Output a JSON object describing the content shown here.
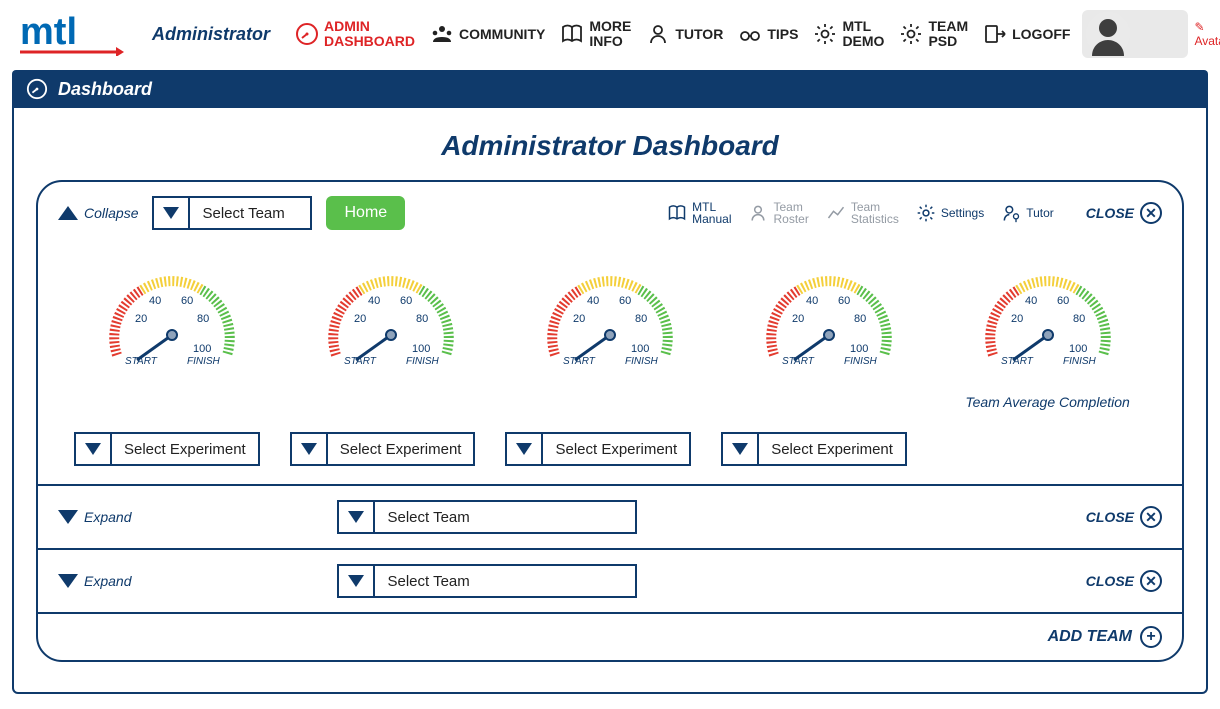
{
  "brand": "mtl",
  "role": "Administrator",
  "nav": [
    {
      "id": "admin-dashboard",
      "line1": "ADMIN",
      "line2": "DASHBOARD",
      "icon": "gauge",
      "active": true
    },
    {
      "id": "community",
      "line1": "COMMUNITY",
      "line2": "",
      "icon": "community",
      "active": false
    },
    {
      "id": "more-info",
      "line1": "MORE",
      "line2": "INFO",
      "icon": "book",
      "active": false
    },
    {
      "id": "tutor",
      "line1": "TUTOR",
      "line2": "",
      "icon": "tutor",
      "active": false
    },
    {
      "id": "tips",
      "line1": "TIPS",
      "line2": "",
      "icon": "glasses",
      "active": false
    },
    {
      "id": "mtl-demo",
      "line1": "MTL",
      "line2": "DEMO",
      "icon": "gear",
      "active": false
    },
    {
      "id": "team-psd",
      "line1": "TEAM",
      "line2": "PSD",
      "icon": "gear",
      "active": false
    },
    {
      "id": "logoff",
      "line1": "LOGOFF",
      "line2": "",
      "icon": "logoff",
      "active": false
    }
  ],
  "avatar": {
    "name": "",
    "edit_label": "Avatar"
  },
  "dashboard_header": "Dashboard",
  "page_title": "Administrator Dashboard",
  "team_expanded": {
    "collapse_label": "Collapse",
    "team_select": "Select Team",
    "home_label": "Home",
    "tools": [
      {
        "id": "mtl-manual",
        "line1": "MTL",
        "line2": "Manual",
        "icon": "book",
        "enabled": true
      },
      {
        "id": "team-roster",
        "line1": "Team",
        "line2": "Roster",
        "icon": "tutor",
        "enabled": false
      },
      {
        "id": "team-statistics",
        "line1": "Team",
        "line2": "Statistics",
        "icon": "chart",
        "enabled": false
      },
      {
        "id": "settings",
        "line1": "Settings",
        "line2": "",
        "icon": "gear",
        "enabled": true
      },
      {
        "id": "tutor",
        "line1": "Tutor",
        "line2": "",
        "icon": "tutor-pin",
        "enabled": true
      }
    ],
    "close_label": "CLOSE",
    "gauge_ticks": {
      "t20": "20",
      "t40": "40",
      "t60": "60",
      "t80": "80",
      "t100": "100",
      "start": "START",
      "finish": "FINISH"
    },
    "gauges": [
      {
        "caption": ""
      },
      {
        "caption": ""
      },
      {
        "caption": ""
      },
      {
        "caption": ""
      },
      {
        "caption": "Team Average Completion"
      }
    ],
    "experiment_select": "Select Experiment"
  },
  "collapsed_rows": [
    {
      "expand_label": "Expand",
      "team_select": "Select Team",
      "close_label": "CLOSE"
    },
    {
      "expand_label": "Expand",
      "team_select": "Select Team",
      "close_label": "CLOSE"
    }
  ],
  "add_team_label": "ADD TEAM"
}
